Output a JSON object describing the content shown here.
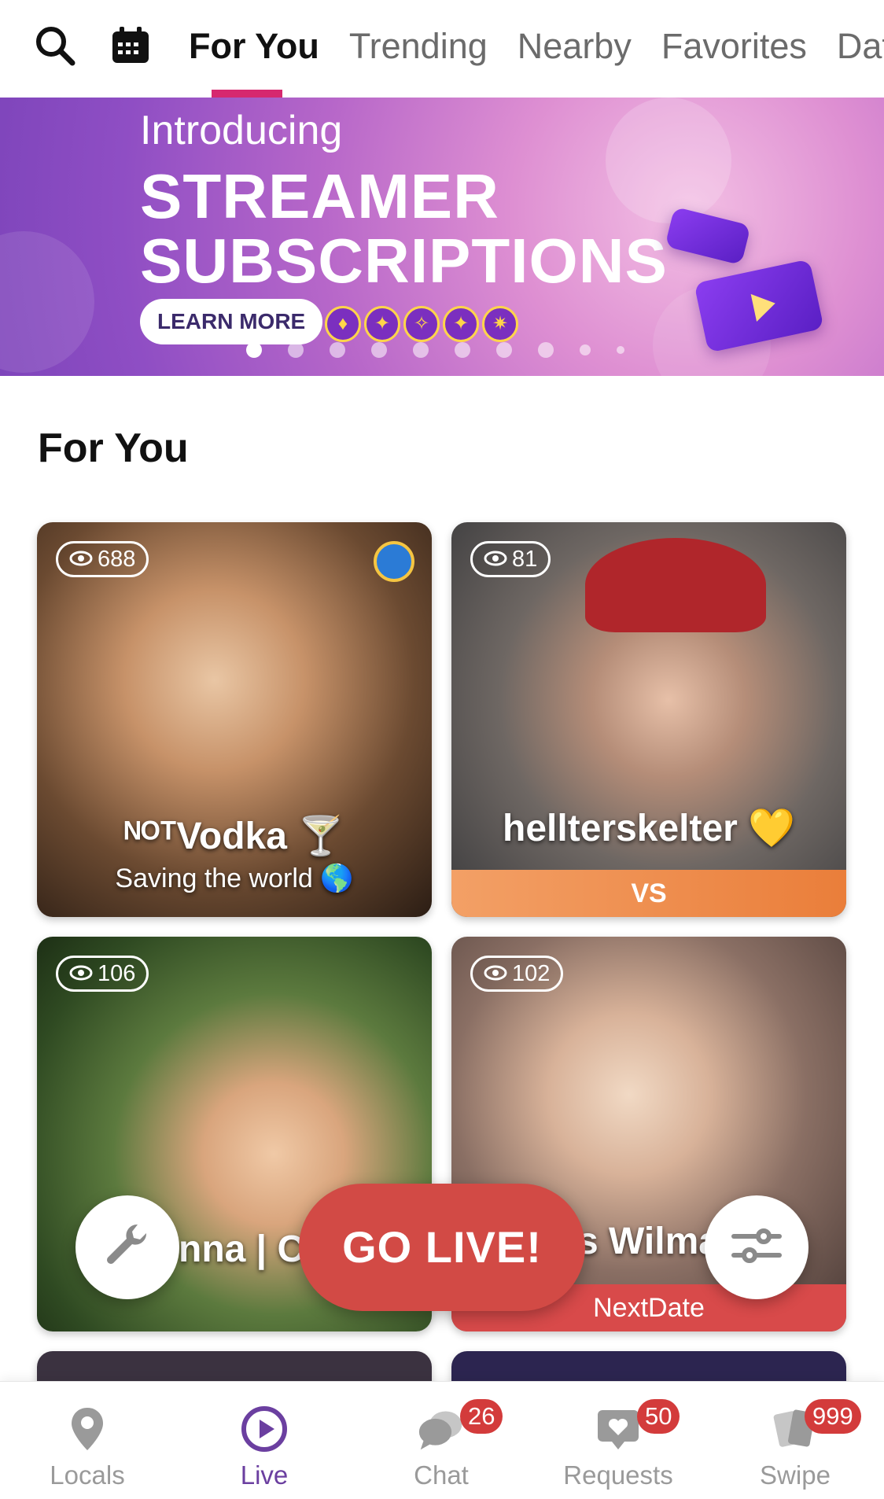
{
  "top_nav": {
    "icons": {
      "search": "search-icon",
      "calendar": "calendar-icon"
    },
    "tabs": [
      {
        "label": "For You",
        "active": true
      },
      {
        "label": "Trending"
      },
      {
        "label": "Nearby"
      },
      {
        "label": "Favorites"
      },
      {
        "label": "Date"
      }
    ],
    "accent_color": "#d6286f"
  },
  "banner": {
    "intro": "Introducing",
    "title_line1": "STREAMER",
    "title_line2": "SUBSCRIPTIONS",
    "cta": "LEARN MORE",
    "slide_count": 10,
    "active_slide": 1
  },
  "section": {
    "title": "For You"
  },
  "cards": [
    {
      "viewers": "688",
      "name": "ᴺᴼᵀVodka 🍸",
      "subtitle": "Saving the world 🌎",
      "band": "",
      "badge": "medal-icon"
    },
    {
      "viewers": "81",
      "name": "hellterskelter 💛",
      "subtitle": "",
      "band": "VS",
      "band_color": "#ec8a45"
    },
    {
      "viewers": "106",
      "name": "nna | Ca",
      "subtitle": "",
      "band": ""
    },
    {
      "viewers": "102",
      "name": "s Wilma",
      "subtitle": "",
      "band": "NextDate",
      "band_color": "#d84a4a"
    }
  ],
  "floating": {
    "go_live": "GO LIVE!",
    "go_live_color": "#d24a45",
    "tools_icon": "wrench-icon",
    "filters_icon": "sliders-icon"
  },
  "bottom_nav": {
    "items": [
      {
        "label": "Locals",
        "icon": "location-pin-icon",
        "badge": ""
      },
      {
        "label": "Live",
        "icon": "play-circle-icon",
        "badge": "",
        "active": true
      },
      {
        "label": "Chat",
        "icon": "chat-bubbles-icon",
        "badge": "26"
      },
      {
        "label": "Requests",
        "icon": "heart-message-icon",
        "badge": "50"
      },
      {
        "label": "Swipe",
        "icon": "cards-icon",
        "badge": "999"
      }
    ],
    "badge_color": "#d33b3b",
    "active_color": "#6b3fa0"
  }
}
